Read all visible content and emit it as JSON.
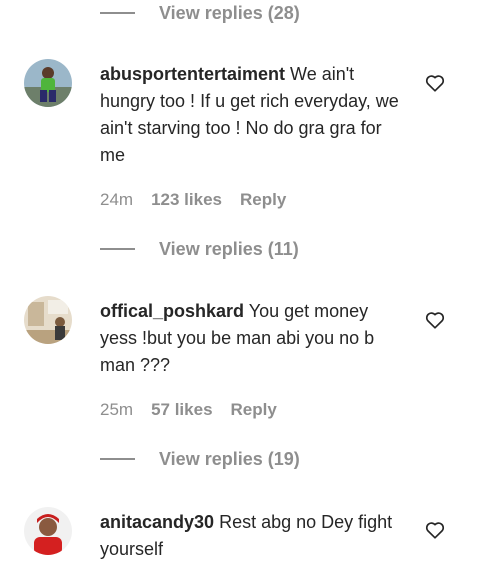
{
  "top_thread": {
    "view_replies": "View replies (28)"
  },
  "comments": [
    {
      "username": "abusportentertaiment",
      "text": " We ain't hungry too ! If u get rich everyday, we ain't starving too ! No do gra gra for me",
      "time": "24m",
      "likes": "123 likes",
      "reply": "Reply",
      "view_replies": "View replies (11)"
    },
    {
      "username": "offical_poshkard",
      "text": " You get money yess !but you be man abi you no b man ???",
      "time": "25m",
      "likes": "57 likes",
      "reply": "Reply",
      "view_replies": "View replies (19)"
    },
    {
      "username": "anitacandy30",
      "text": " Rest abg no Dey fight yourself"
    }
  ],
  "icons": {
    "like": "heart-outline-icon"
  },
  "colors": {
    "primary_text": "#262626",
    "secondary_text": "#8e8e8e",
    "background": "#ffffff"
  }
}
